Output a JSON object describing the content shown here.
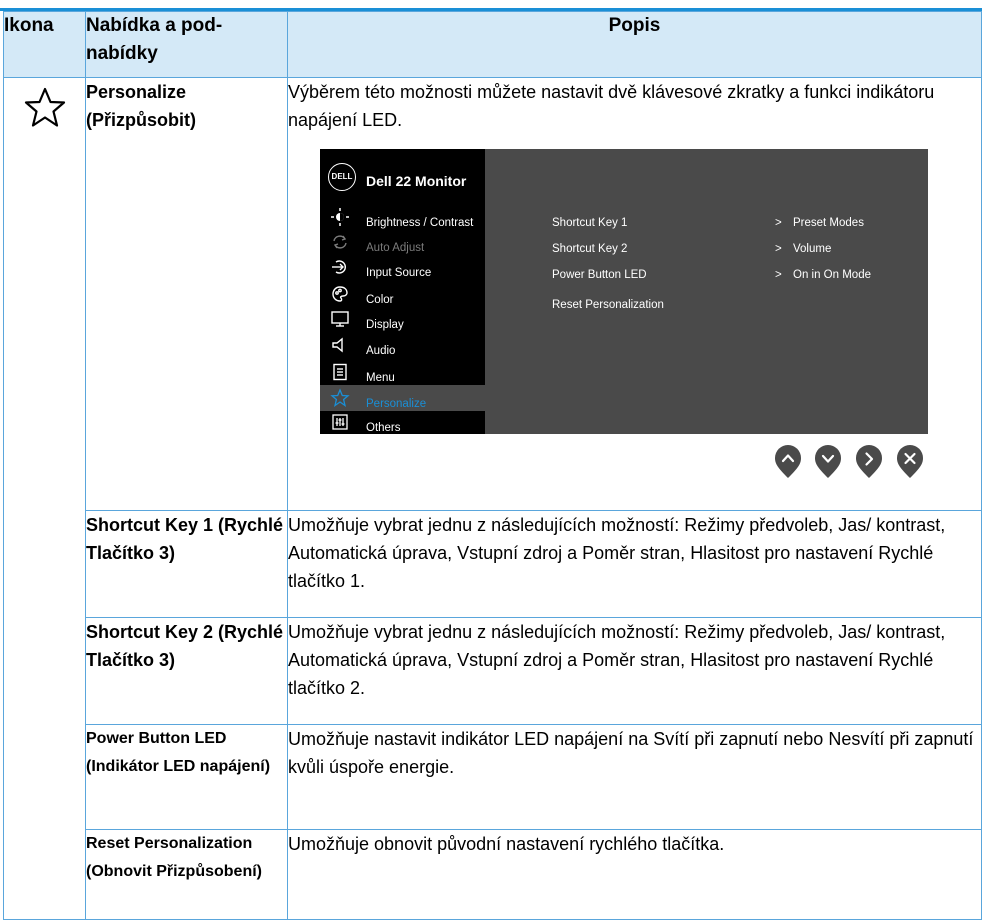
{
  "header": {
    "col_icon": "Ikona",
    "col_menu": "Nabídka a pod-nabídky",
    "col_desc": "Popis"
  },
  "rows": [
    {
      "icon": "star-icon",
      "menu": "Personalize (Přizpůsobit)",
      "desc": "Výběrem této možnosti můžete nastavit dvě klávesové zkratky a funkci indikátoru napájení LED."
    },
    {
      "menu": "Shortcut Key 1 (Rychlé Tlačítko 3)",
      "desc": "Umožňuje vybrat jednu z následujících možností: Režimy předvoleb, Jas/ kontrast, Automatická úprava, Vstupní zdroj a Poměr stran, Hlasitost pro nastavení Rychlé tlačítko 1."
    },
    {
      "menu": "Shortcut Key 2 (Rychlé Tlačítko 3)",
      "desc": "Umožňuje vybrat jednu z následujících možností: Režimy předvoleb, Jas/ kontrast, Automatická úprava, Vstupní zdroj a Poměr stran, Hlasitost pro nastavení Rychlé tlačítko 2."
    },
    {
      "menu": "Power Button LED (Indikátor LED napájení)",
      "desc": "Umožňuje nastavit indikátor LED napájení na Svítí při zapnutí nebo Nesvítí při zapnutí kvůli úspoře energie."
    },
    {
      "menu": "Reset Personalization (Obnovit Přizpůsobení)",
      "desc": "Umožňuje obnovit původní nastavení rychlého tlačítka."
    }
  ],
  "osd": {
    "logo": "DELL",
    "title": "Dell 22 Monitor",
    "menu": [
      {
        "label": "Brightness / Contrast",
        "icon": "brightness-icon",
        "state": "normal"
      },
      {
        "label": "Auto Adjust",
        "icon": "auto-adjust-icon",
        "state": "disabled"
      },
      {
        "label": "Input Source",
        "icon": "input-source-icon",
        "state": "normal"
      },
      {
        "label": "Color",
        "icon": "color-icon",
        "state": "normal"
      },
      {
        "label": "Display",
        "icon": "display-icon",
        "state": "normal"
      },
      {
        "label": "Audio",
        "icon": "audio-icon",
        "state": "normal"
      },
      {
        "label": "Menu",
        "icon": "menu-icon",
        "state": "normal"
      },
      {
        "label": "Personalize",
        "icon": "star-icon",
        "state": "selected"
      },
      {
        "label": "Others",
        "icon": "others-icon",
        "state": "normal"
      }
    ],
    "submenu": [
      {
        "label": "Shortcut Key 1",
        "arrow": ">",
        "value": "Preset Modes"
      },
      {
        "label": "Shortcut Key 2",
        "arrow": ">",
        "value": "Volume"
      },
      {
        "label": "Power Button LED",
        "arrow": ">",
        "value": "On in On Mode"
      },
      {
        "label": "Reset Personalization",
        "arrow": "",
        "value": ""
      }
    ],
    "nav_buttons": [
      "up-button",
      "down-button",
      "right-button",
      "close-button"
    ],
    "colors": {
      "accent": "#1a8fd6",
      "header_bg": "#d4e9f7",
      "osd_panel": "#4a4a4a",
      "osd_sidebar": "#000000"
    }
  }
}
